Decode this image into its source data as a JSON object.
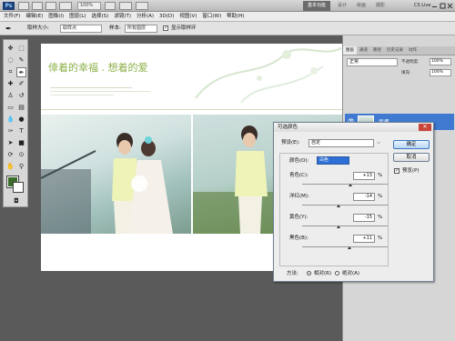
{
  "appbar": {
    "logo": "Ps",
    "zoom": "100%",
    "workspaces": [
      "基本功能",
      "设计",
      "绘画",
      "摄影"
    ],
    "cslive": "CS Live"
  },
  "menu": [
    "文件(F)",
    "编辑(E)",
    "图像(I)",
    "图层(L)",
    "选择(S)",
    "滤镜(T)",
    "分析(A)",
    "3D(D)",
    "视图(V)",
    "窗口(W)",
    "帮助(H)"
  ],
  "options": {
    "sample_size_label": "取样大小:",
    "sample_size_value": "取样点",
    "sample_label": "样本:",
    "sample_value": "所有图层",
    "show_ring_label": "显示取样环"
  },
  "canvas": {
    "title": "倖着的幸福 . 想着的爱"
  },
  "panel": {
    "tabs": [
      "图层",
      "通道",
      "路径",
      "历史记录",
      "动作"
    ],
    "blend_mode": "正常",
    "opacity_label": "不透明度:",
    "opacity_value": "100%",
    "fill_label": "填充:",
    "fill_value": "100%",
    "layer_name": "背景"
  },
  "dialog": {
    "title": "可选颜色",
    "preset_label": "预设(E):",
    "preset_value": "自定",
    "color_label": "颜色(O):",
    "color_value": "白色",
    "sliders": [
      {
        "label": "青色(C):",
        "value": "+13",
        "unit": "%",
        "pos": 0.565
      },
      {
        "label": "洋红(M):",
        "value": "-14",
        "unit": "%",
        "pos": 0.43
      },
      {
        "label": "黄色(Y):",
        "value": "-15",
        "unit": "%",
        "pos": 0.425
      },
      {
        "label": "黑色(B):",
        "value": "+11",
        "unit": "%",
        "pos": 0.555
      }
    ],
    "ok": "确定",
    "cancel": "取消",
    "preview_label": "预览(P)",
    "method_label": "方法:",
    "relative": "相对(R)",
    "absolute": "绝对(A)"
  }
}
